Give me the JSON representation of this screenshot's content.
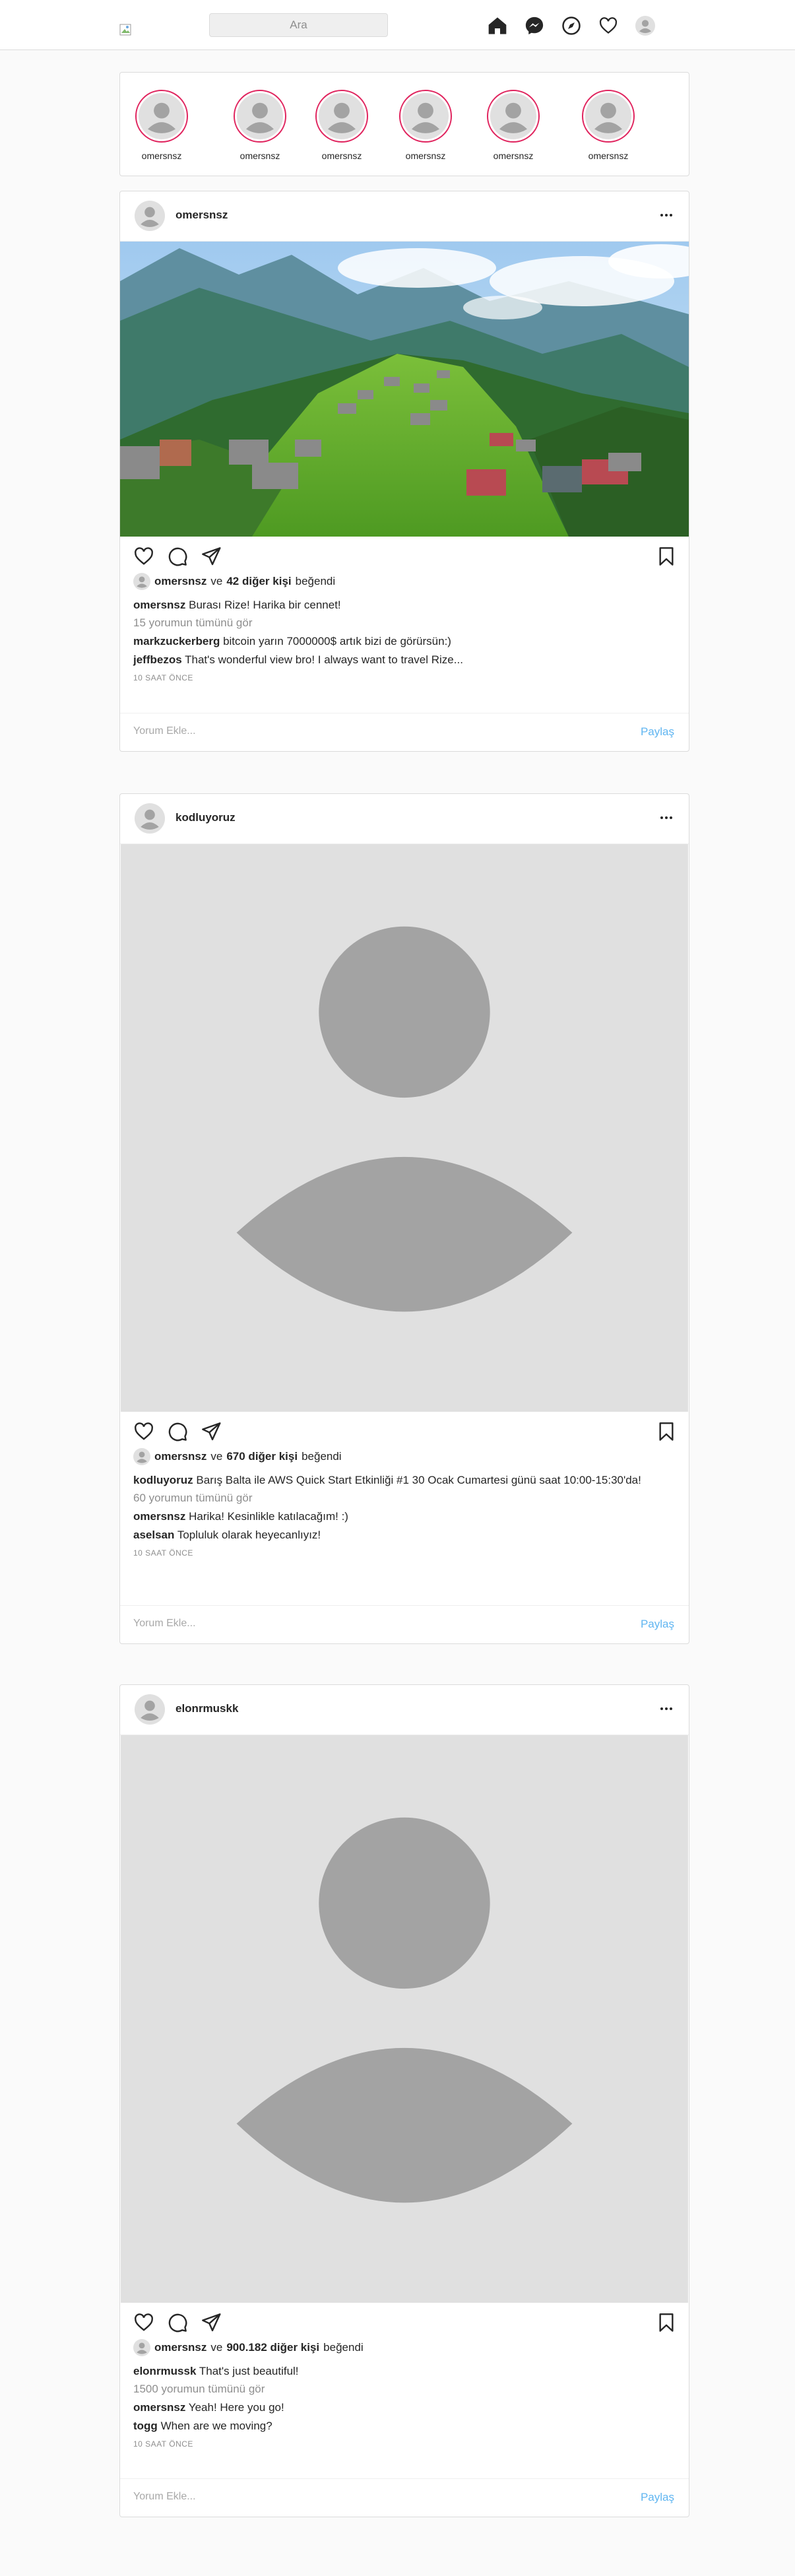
{
  "header": {
    "search_placeholder": "Ara"
  },
  "stories": [
    {
      "name": "omersnsz"
    },
    {
      "name": "omersnsz"
    },
    {
      "name": "omersnsz"
    },
    {
      "name": "omersnsz"
    },
    {
      "name": "omersnsz"
    },
    {
      "name": "omersnsz"
    }
  ],
  "posts": [
    {
      "username": "omersnsz",
      "liked_by": "omersnsz",
      "liked_conj": "ve",
      "likes_others": "42 diğer kişi",
      "liked_word": "beğendi",
      "caption_user": "omersnsz",
      "caption_text": "Burası Rize! Harika bir cennet!",
      "view_all": "15 yorumun tümünü gör",
      "comments": [
        {
          "user": "markzuckerberg",
          "text": "bitcoin yarın 7000000$ artık bizi de görürsün:)"
        },
        {
          "user": "jeffbezos",
          "text": "That's wonderful view bro! I always want to travel Rize..."
        }
      ],
      "time": "10 SAAT ÖNCE",
      "comment_placeholder": "Yorum Ekle...",
      "share_label": "Paylaş"
    },
    {
      "username": "kodluyoruz",
      "liked_by": "omersnsz",
      "liked_conj": "ve",
      "likes_others": "670 diğer kişi",
      "liked_word": "beğendi",
      "caption_user": "kodluyoruz",
      "caption_text": "Barış Balta ile AWS Quick Start Etkinliği #1 30 Ocak Cumartesi günü saat 10:00-15:30'da!",
      "view_all": "60 yorumun tümünü gör",
      "comments": [
        {
          "user": "omersnsz",
          "text": "Harika! Kesinlikle katılacağım! :)"
        },
        {
          "user": "aselsan",
          "text": "Topluluk olarak heyecanlıyız!"
        }
      ],
      "time": "10 SAAT ÖNCE",
      "comment_placeholder": "Yorum Ekle...",
      "share_label": "Paylaş"
    },
    {
      "username": "elonrmuskk",
      "liked_by": "omersnsz",
      "liked_conj": "ve",
      "likes_others": "900.182 diğer kişi",
      "liked_word": "beğendi",
      "caption_user": "elonrmussk",
      "caption_text": "That's just beautiful!",
      "view_all": "1500 yorumun tümünü gör",
      "comments": [
        {
          "user": "omersnsz",
          "text": "Yeah! Here you go!"
        },
        {
          "user": "togg",
          "text": "When are we moving?"
        }
      ],
      "time": "10 SAAT ÖNCE",
      "comment_placeholder": "Yorum Ekle...",
      "share_label": "Paylaş"
    }
  ]
}
